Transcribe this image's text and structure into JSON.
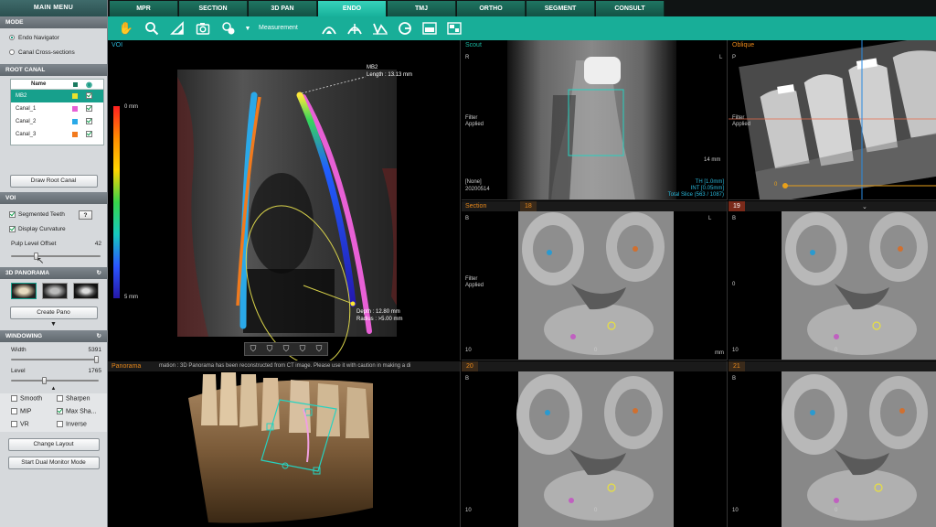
{
  "left_panel": {
    "title": "MAIN MENU",
    "mode": {
      "header": "MODE",
      "options": [
        "Endo Navigator",
        "Canal Cross-sections"
      ],
      "selected": 0
    },
    "root_canal": {
      "header": "ROOT CANAL",
      "col_name": "Name",
      "rows": [
        {
          "name": "MB2",
          "color": "#e8e22c",
          "selected": true
        },
        {
          "name": "Canal_1",
          "color": "#e860d6",
          "selected": false
        },
        {
          "name": "Canal_2",
          "color": "#29a9e8",
          "selected": false
        },
        {
          "name": "Canal_3",
          "color": "#f27a1e",
          "selected": false
        }
      ],
      "draw_button": "Draw Root Canal"
    },
    "voi": {
      "header": "VOI",
      "segmented_teeth": "Segmented Teeth",
      "help": "?",
      "display_curvature": "Display Curvature",
      "pulp_label": "Pulp Level Offset",
      "pulp_value": "42",
      "pulp_fraction": 0.28
    },
    "panorama3d": {
      "header": "3D PANORAMA",
      "create_button": "Create Pano"
    },
    "windowing": {
      "header": "WINDOWING",
      "width_label": "Width",
      "width_value": "5391",
      "width_fraction": 0.98,
      "level_label": "Level",
      "level_value": "1765",
      "level_fraction": 0.38
    },
    "options": [
      {
        "label": "Smooth",
        "checked": false
      },
      {
        "label": "Sharpen",
        "checked": false
      },
      {
        "label": "MIP",
        "checked": false
      },
      {
        "label": "Max Sha...",
        "checked": true
      },
      {
        "label": "VR",
        "checked": false
      },
      {
        "label": "Inverse",
        "checked": false
      }
    ],
    "change_layout": "Change Layout",
    "dual_monitor": "Start Dual Monitor Mode"
  },
  "tabs": [
    "MPR",
    "SECTION",
    "3D PAN",
    "ENDO",
    "TMJ",
    "ORTHO",
    "SEGMENT",
    "CONSULT"
  ],
  "active_tab": "ENDO",
  "toolbar": {
    "measurement_label": "Measurement"
  },
  "voi_view": {
    "label": "VOI",
    "scale_top": "0 mm",
    "scale_bottom": "5 mm",
    "canal_name": "MB2",
    "length": "Length : 13.13 mm",
    "depth": "Depth : 12.80 mm",
    "radius": "Radius : >5.00 mm"
  },
  "scout": {
    "label": "Scout",
    "left_marker": "R",
    "right_marker": "L",
    "filter_line1": "Filter",
    "filter_line2": "Applied",
    "scale": "14 mm",
    "info1": "[None]",
    "info2": "20200514",
    "th": "TH [1.0mm]",
    "int": "INT [0.05mm]",
    "total": "Total Slice (563 / 1087)"
  },
  "oblique": {
    "label": "Oblique",
    "top_marker": "P",
    "filter_line1": "Filter",
    "filter_line2": "Applied",
    "zero": "0"
  },
  "panorama": {
    "label": "Panorama",
    "notice": "mation : 3D Panorama has been reconstructed from CT image. Please use it with caution in making a di"
  },
  "sections": [
    {
      "label": "Section",
      "number": "18",
      "top": "B",
      "bottom": "10",
      "center": "0",
      "filter1": "Filter",
      "filter2": "Applied",
      "side": "L",
      "mm": "mm"
    },
    {
      "label": "",
      "number": "19",
      "top": "B",
      "bottom": "10",
      "center": "0",
      "mid": "0",
      "side": "L"
    },
    {
      "label": "",
      "number": "20",
      "top": "B",
      "bottom": "10",
      "center": "0"
    },
    {
      "label": "",
      "number": "21",
      "top": "B",
      "bottom": "10",
      "center": "0"
    }
  ],
  "colors": {
    "accent": "#18ae98",
    "active_tab": "#2fc8b0",
    "tab": "#1c6a59",
    "orange": "#e8881a",
    "cyan": "#1ab8a0"
  }
}
